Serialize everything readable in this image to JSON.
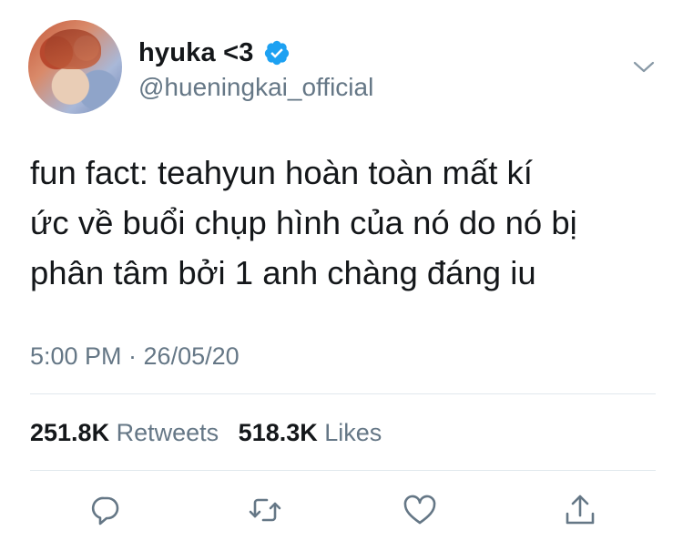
{
  "author": {
    "display_name": "hyuka <3",
    "handle": "@hueningkai_official",
    "verified": true,
    "avatar_icon": "profile-photo"
  },
  "tweet": {
    "text_lines": [
      "fun fact: teahyun hoàn toàn mất kí",
      "ức về buổi chụp hình của nó do nó bị",
      "phân tâm bởi 1 anh chàng đáng iu"
    ],
    "timestamp": "5:00 PM · 26/05/20"
  },
  "stats": {
    "retweets_count": "251.8K",
    "retweets_label": "Retweets",
    "likes_count": "518.3K",
    "likes_label": "Likes"
  },
  "actions": [
    {
      "name": "reply",
      "icon": "speech-bubble-icon"
    },
    {
      "name": "retweet",
      "icon": "retweet-arrows-icon"
    },
    {
      "name": "like",
      "icon": "heart-icon"
    },
    {
      "name": "share",
      "icon": "share-upload-icon"
    }
  ],
  "colors": {
    "primary_text": "#14171a",
    "secondary_text": "#657786",
    "verified_blue": "#1da1f2",
    "divider": "#e1e8ed"
  }
}
